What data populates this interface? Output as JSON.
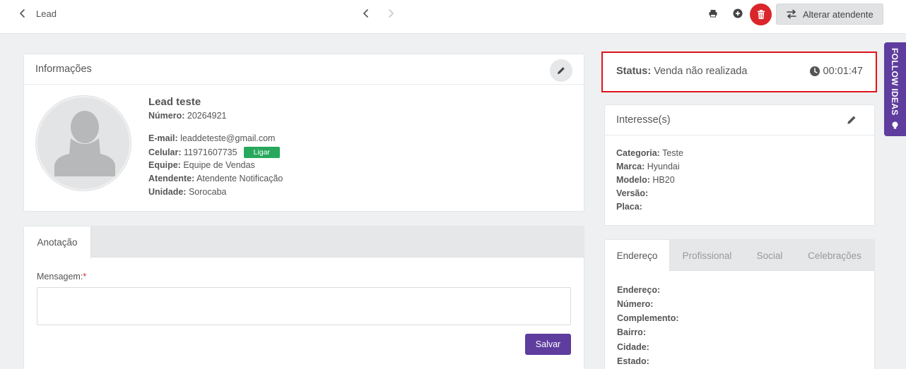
{
  "header": {
    "breadcrumb": "Lead",
    "alterar_label": "Alterar atendente"
  },
  "follow_tab": {
    "label": "FOLLOW IDEAS"
  },
  "info": {
    "title": "Informações",
    "name": "Lead teste",
    "numero_label": "Número:",
    "numero": "20264921",
    "email_label": "E-mail:",
    "email": "leaddeteste@gmail.com",
    "celular_label": "Celular:",
    "celular": "11971607735",
    "ligar_label": "Ligar",
    "equipe_label": "Equipe:",
    "equipe": "Equipe de Vendas",
    "atendente_label": "Atendente:",
    "atendente": "Atendente Notificação",
    "unidade_label": "Unidade:",
    "unidade": "Sorocaba"
  },
  "note": {
    "tab_label": "Anotação",
    "message_label": "Mensagem:",
    "required_mark": "*",
    "message_value": "",
    "save_label": "Salvar"
  },
  "status": {
    "label": "Status:",
    "value": "Venda não realizada",
    "timer": "00:01:47"
  },
  "interesse": {
    "title": "Interesse(s)",
    "categoria_label": "Categoria:",
    "categoria": "Teste",
    "marca_label": "Marca:",
    "marca": "Hyundai",
    "modelo_label": "Modelo:",
    "modelo": "HB20",
    "versao_label": "Versão:",
    "versao": "",
    "placa_label": "Placa:",
    "placa": ""
  },
  "address": {
    "tabs": [
      "Endereço",
      "Profissional",
      "Social",
      "Celebrações"
    ],
    "fields": [
      "Endereço:",
      "Número:",
      "Complemento:",
      "Bairro:",
      "Cidade:",
      "Estado:"
    ]
  },
  "colors": {
    "accent": "#5e3d9e",
    "danger": "#d9262c",
    "success": "#27a85d",
    "status_border": "#e0141b"
  },
  "icons": [
    "chevron-left-icon",
    "chevron-right-icon",
    "printer-icon",
    "plus-circle-icon",
    "trash-icon",
    "swap-arrows-icon",
    "pencil-icon",
    "clock-icon",
    "lightbulb-icon",
    "user-silhouette-icon"
  ]
}
